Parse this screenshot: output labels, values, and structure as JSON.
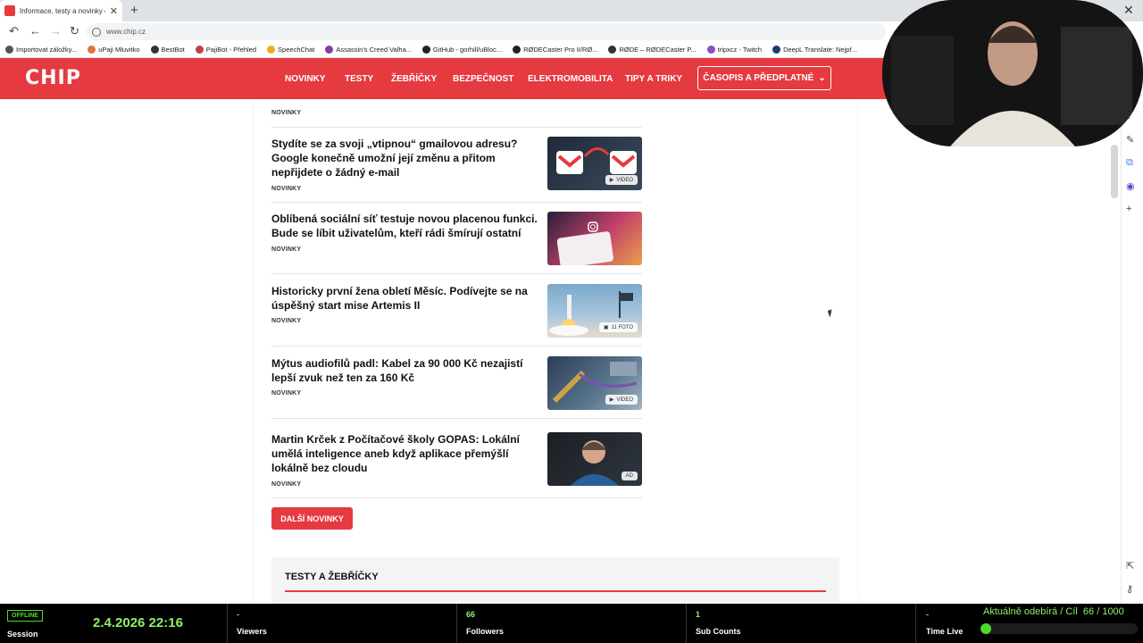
{
  "browser": {
    "tab_title": "Informace, testy a novinky o har",
    "url": "www.chip.cz",
    "bookmarks": [
      "Importovat záložky...",
      "uPaji Mluvitko",
      "BestBot",
      "PajiBot - Přehled",
      "SpeechChat",
      "Assassin's Creed Valha...",
      "GitHub - gorhill/uBloc...",
      "RØDECaster Pro II/RØ...",
      "RØDE – RØDECaster P...",
      "tripxcz - Twitch",
      "DeepL Translate: Nejpř..."
    ]
  },
  "site": {
    "logo": "CHIP",
    "nav": [
      "NOVINKY",
      "TESTY",
      "ŽEBŘÍČKY",
      "BEZPEČNOST",
      "ELEKTROMOBILITA",
      "TIPY A TRIKY"
    ],
    "subscribe": "ČASOPIS A PŘEDPLATNÉ",
    "top_category": "NOVINKY",
    "articles": [
      {
        "title": "Stydíte se za svoji „vtipnou“ gmailovou adresu? Google konečně umožní její změnu a přitom nepřijdete o žádný e-mail",
        "category": "NOVINKY",
        "badge": "VIDEO",
        "thumb_icon": "gmail-icon"
      },
      {
        "title": "Oblíbená sociální síť testuje novou placenou funkci. Bude se líbit uživatelům, kteří rádi šmírují ostatní",
        "category": "NOVINKY",
        "badge": "",
        "thumb_icon": "instagram-icon"
      },
      {
        "title": "Historicky první žena obletí Měsíc. Podívejte se na úspěšný start mise Artemis II",
        "category": "NOVINKY",
        "badge": "11 FOTO",
        "thumb_icon": "rocket-icon"
      },
      {
        "title": "Mýtus audiofilů padl: Kabel za 90 000 Kč nezajistí lepší zvuk než ten za 160 Kč",
        "category": "NOVINKY",
        "badge": "VIDEO",
        "thumb_icon": "cable-icon"
      },
      {
        "title": "Martin Krček z Počítačové školy GOPAS: Lokální umělá inteligence aneb když aplikace přemýšlí lokálně bez cloudu",
        "category": "NOVINKY",
        "badge": "AD",
        "thumb_icon": "person-icon"
      }
    ],
    "more_button": "DALŠÍ NOVINKY",
    "section_title": "TESTY A ŽEBŘÍČKY"
  },
  "stream": {
    "status": "OFFLINE",
    "session_label": "Session",
    "datetime": "2.4.2026 22:16",
    "viewers_value": "-",
    "viewers_label": "Viewers",
    "followers_value": "66",
    "followers_label": "Followers",
    "subs_value": "1",
    "subs_label": "Sub Counts",
    "timelive_value": "-",
    "timelive_label": "Time Live",
    "goal_label": "Aktuálně odebírá / Cíl",
    "goal_value": "66 / 1000",
    "goal_fraction": 0.066
  }
}
